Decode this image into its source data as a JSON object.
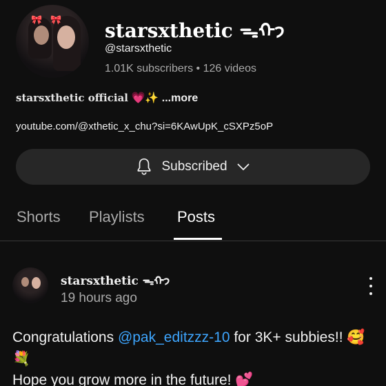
{
  "channel": {
    "name": "starsxthetic",
    "name_suffix": "ᯓᡣ𐭩",
    "handle": "@starsxthetic",
    "subscribers": "1.01K subscribers",
    "separator": "•",
    "videos": "126 videos",
    "description_name": "starsxthetic official",
    "description_emoji": "💗✨",
    "description_more": "...more",
    "link": "youtube.com/@xthetic_x_chu?si=6KAwUpK_cSXPz5oP"
  },
  "subscribe_button": {
    "label": "Subscribed",
    "icon": "bell-icon",
    "chevron": "chevron-down-icon"
  },
  "tabs": [
    {
      "label": "Shorts",
      "active": false
    },
    {
      "label": "Playlists",
      "active": false
    },
    {
      "label": "Posts",
      "active": true
    }
  ],
  "post": {
    "author": "starsxthetic",
    "author_suffix": "ᯓᡣ𐭩",
    "time": "19 hours ago",
    "text_before": "Congratulations ",
    "mention": "@pak_editzzz-10",
    "text_after": " for 3K+ subbies!! 🥰💐",
    "line2": " Hope you grow more in the future! 💕"
  },
  "colors": {
    "background": "#0f0f0f",
    "button": "#272727",
    "muted": "#aaaaaa",
    "mention": "#3ea6ff"
  }
}
